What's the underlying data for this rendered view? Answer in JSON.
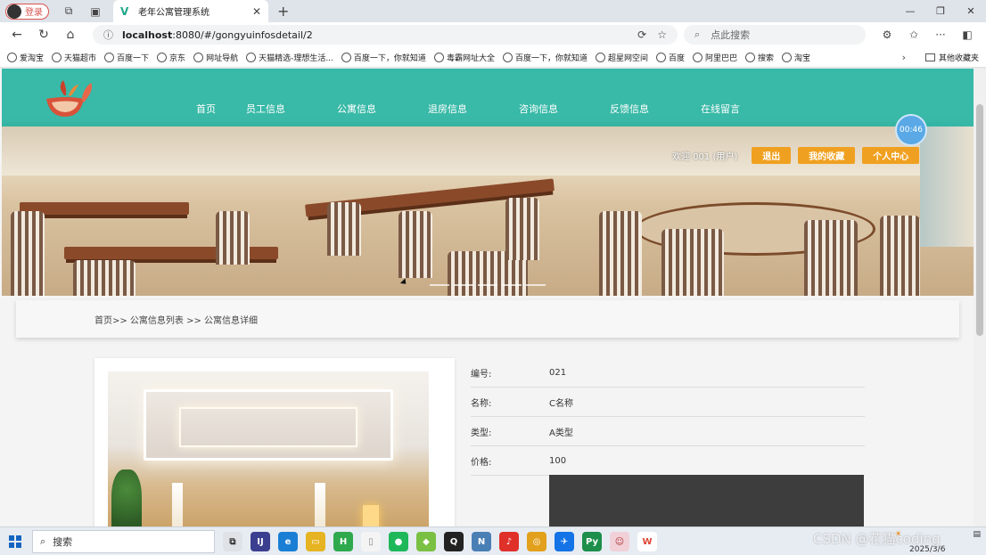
{
  "browser": {
    "login_label": "登录",
    "tab_title": "老年公寓管理系统",
    "url_host": "localhost",
    "url_rest": ":8080/#/gongyuinfosdetail/2",
    "search_placeholder": "点此搜索",
    "bookmarks": [
      "爱淘宝",
      "天猫超市",
      "百度一下",
      "京东",
      "网址导航",
      "天猫精选-理想生活...",
      "百度一下，你就知道",
      "毒霸网址大全",
      "百度一下，你就知道",
      "超星网空间",
      "百度",
      "阿里巴巴",
      "搜索",
      "淘宝"
    ],
    "other_bookmarks": "其他收藏夹"
  },
  "site": {
    "nav": [
      "首页",
      "员工信息",
      "公寓信息",
      "退房信息",
      "咨询信息",
      "反馈信息",
      "在线留言"
    ],
    "welcome": "欢迎 001 (用户)",
    "logout": "退出",
    "favorites": "我的收藏",
    "profile": "个人中心",
    "timer": "00:46"
  },
  "breadcrumb": "首页>> 公寓信息列表 >> 公寓信息详细",
  "detail": {
    "rows": [
      {
        "label": "编号:",
        "value": "021"
      },
      {
        "label": "名称:",
        "value": "C名称"
      },
      {
        "label": "类型:",
        "value": "A类型"
      },
      {
        "label": "价格:",
        "value": "100"
      }
    ]
  },
  "taskbar": {
    "search_label": "搜索",
    "date": "2025/3/6",
    "watermark": "CSDN @花猫coding"
  }
}
